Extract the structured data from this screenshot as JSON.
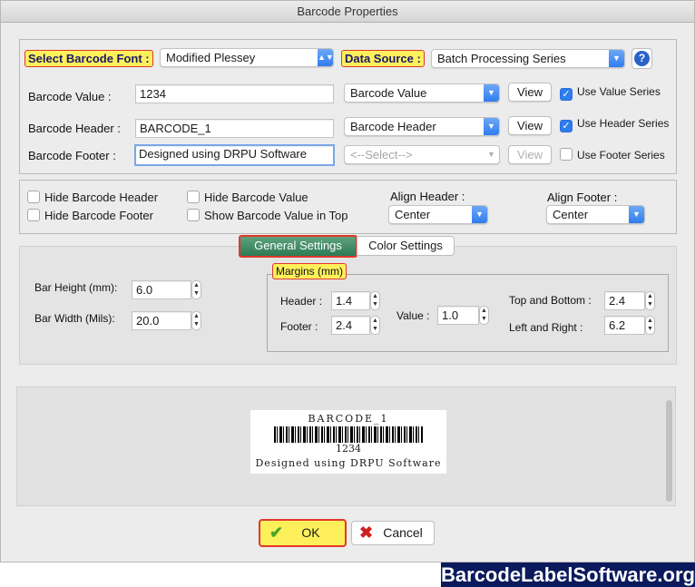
{
  "window": {
    "title": "Barcode Properties"
  },
  "top_group": {
    "font_label": "Select Barcode Font :",
    "font_value": "Modified Plessey",
    "source_label": "Data Source :",
    "source_value": "Batch Processing Series",
    "rows": [
      {
        "label": "Barcode Value :",
        "text": "1234",
        "popup": "Barcode Value",
        "view": "View",
        "series": "Use Value Series"
      },
      {
        "label": "Barcode Header :",
        "text": "BARCODE_1",
        "popup": "Barcode Header",
        "view": "View",
        "series": "Use Header Series"
      },
      {
        "label": "Barcode Footer :",
        "text": "Designed using DRPU Software",
        "popup": "<--Select-->",
        "view": "View",
        "series": "Use Footer Series"
      }
    ]
  },
  "options_group": {
    "hide_header": "Hide Barcode Header",
    "hide_footer": "Hide Barcode Footer",
    "hide_value": "Hide Barcode Value",
    "show_value_top": "Show Barcode Value in Top",
    "align_header_label": "Align Header :",
    "align_header_value": "Center",
    "align_footer_label": "Align Footer :",
    "align_footer_value": "Center"
  },
  "tabs": {
    "general": "General Settings",
    "color": "Color Settings"
  },
  "general": {
    "bar_height_label": "Bar Height (mm):",
    "bar_height": "6.0",
    "bar_width_label": "Bar Width (Mils):",
    "bar_width": "20.0",
    "margins_title": "Margins (mm)",
    "header_label": "Header :",
    "header": "1.4",
    "footer_label": "Footer :",
    "footer": "2.4",
    "value_label": "Value :",
    "value": "1.0",
    "top_bottom_label": "Top and Bottom :",
    "top_bottom": "2.4",
    "left_right_label": "Left and Right :",
    "left_right": "6.2"
  },
  "preview": {
    "header": "BARCODE_1",
    "value": "1234",
    "footer": "Designed using DRPU Software"
  },
  "buttons": {
    "ok": "OK",
    "cancel": "Cancel"
  },
  "brand": "BarcodeLabelSoftware.org",
  "colors": {
    "accent_blue": "#2f7cf0",
    "highlight_yellow": "#fdf05a",
    "highlight_border": "#e1382b",
    "brand_bg": "#0b1a5c",
    "tab_green": "#2d7b55"
  }
}
